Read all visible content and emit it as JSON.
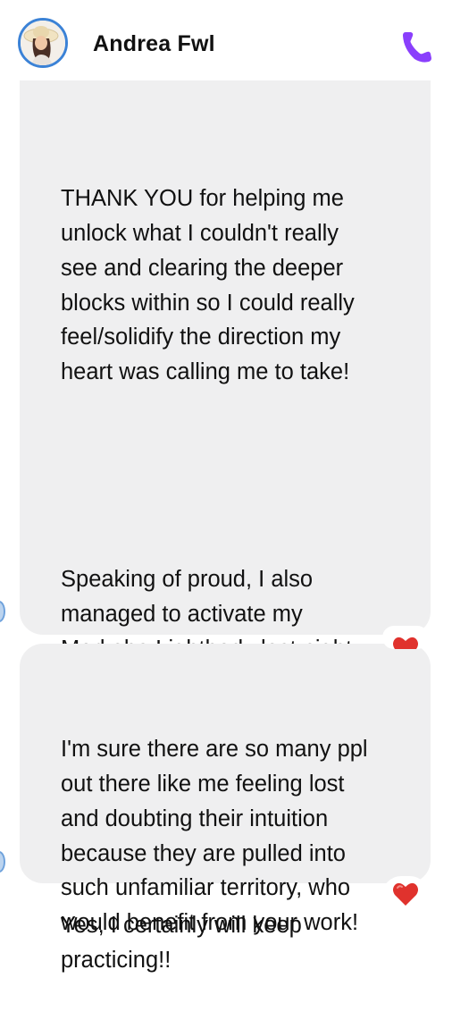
{
  "header": {
    "contact_name": "Andrea Fwl",
    "avatar_icon": "profile-photo-avatar",
    "call_icon": "phone-icon",
    "accent_color": "#8a3ffc"
  },
  "messages": [
    {
      "paragraphs": [
        "THANK YOU for helping me\nunlock what I couldn't really\nsee and clearing the deeper\nblocks within so I could really\nfeel/solidify the direction my\nheart was calling me to take!",
        "Speaking of proud, I also\nmanaged to activate my\nMerkaba Lightbody last night\nand oh em gee..excited to try\nout astral travelling!",
        "Yes, I certainly will keep\npracticing!!"
      ],
      "reaction": "heart"
    },
    {
      "paragraphs": [
        "I'm sure there are so many ppl\nout there like me feeling lost\nand doubting their intuition\nbecause they are pulled into\nsuch unfamiliar territory, who\nwould benefit from your work!"
      ],
      "reaction": "heart"
    }
  ],
  "colors": {
    "bubble_bg": "#efeff0",
    "reaction_heart": "#e0322d"
  }
}
